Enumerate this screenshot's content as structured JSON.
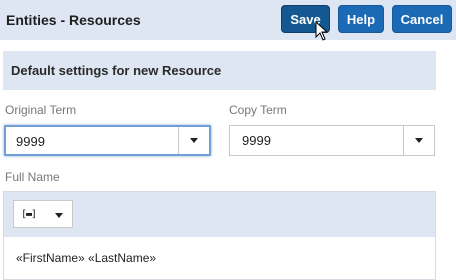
{
  "header": {
    "title": "Entities - Resources",
    "buttons": {
      "save": "Save",
      "help": "Help",
      "cancel": "Cancel"
    }
  },
  "section": {
    "title": "Default settings for new Resource"
  },
  "fields": {
    "original_term": {
      "label": "Original Term",
      "value": "9999"
    },
    "copy_term": {
      "label": "Copy Term",
      "value": "9999"
    },
    "full_name": {
      "label": "Full Name",
      "toolbar_icon": "field-insert-icon",
      "content": "«FirstName» «LastName»"
    }
  },
  "colors": {
    "accent": "#1b6ab5",
    "header_bg": "#dde6f2"
  }
}
